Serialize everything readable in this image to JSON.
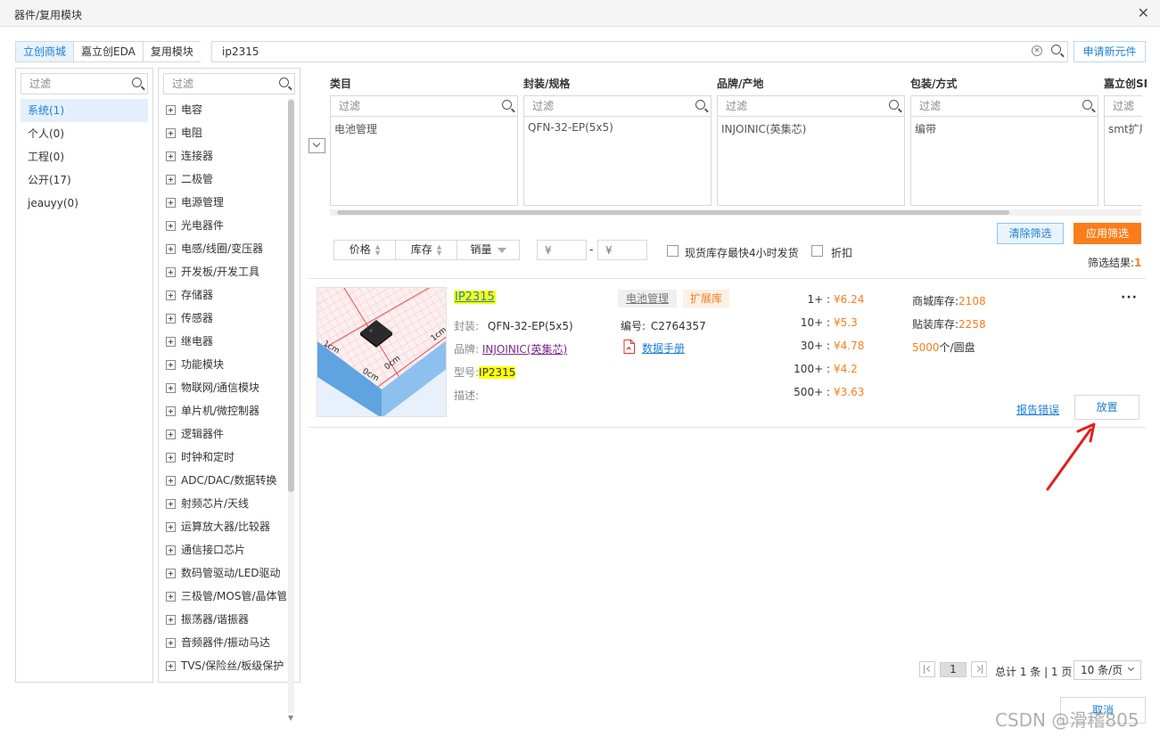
{
  "window": {
    "title": "器件/复用模块",
    "close": "✕"
  },
  "tabs": [
    {
      "label": "立创商城",
      "active": true
    },
    {
      "label": "嘉立创EDA",
      "active": false
    },
    {
      "label": "复用模块",
      "active": false
    }
  ],
  "search": {
    "value": "ip2315",
    "clear": "✕"
  },
  "new_part_button": "申请新元件",
  "filter_placeholder": "过滤",
  "libraries": [
    "系统(1)",
    "个人(0)",
    "工程(0)",
    "公开(17)",
    "jeauyy(0)"
  ],
  "categories": [
    "电容",
    "电阻",
    "连接器",
    "二极管",
    "电源管理",
    "光电器件",
    "电感/线圈/变压器",
    "开发板/开发工具",
    "存储器",
    "传感器",
    "继电器",
    "功能模块",
    "物联网/通信模块",
    "单片机/微控制器",
    "逻辑器件",
    "时钟和定时",
    "ADC/DAC/数据转换",
    "射频芯片/天线",
    "运算放大器/比较器",
    "通信接口芯片",
    "数码管驱动/LED驱动",
    "三极管/MOS管/晶体管",
    "振荡器/谐振器",
    "音频器件/振动马达",
    "TVS/保险丝/板级保护"
  ],
  "facets": [
    {
      "title": "类目",
      "value": "电池管理"
    },
    {
      "title": "封装/规格",
      "value": "QFN-32-EP(5x5)"
    },
    {
      "title": "品牌/产地",
      "value": "INJOINIC(英集芯)"
    },
    {
      "title": "包装/方式",
      "value": "编带"
    },
    {
      "title": "嘉立创SMT",
      "value": "smt扩展"
    }
  ],
  "buttons": {
    "clear_filter": "清除筛选",
    "apply_filter": "应用筛选",
    "place": "放置",
    "report": "报告错误",
    "cancel": "取消"
  },
  "sort": {
    "price": "价格",
    "stock": "库存",
    "sales": "销量"
  },
  "price_range": {
    "min_placeholder": "¥",
    "max_placeholder": "¥",
    "dash": "-"
  },
  "checks": {
    "fast_ship": "现货库存最快4小时发货",
    "discount": "折扣"
  },
  "result": {
    "label": "筛选结果:",
    "count": "1"
  },
  "product": {
    "name": "IP2315",
    "category_tag": "电池管理",
    "lib_tag": "扩展库",
    "package_label": "封装:",
    "package": "QFN-32-EP(5x5)",
    "brand_label": "品牌:",
    "brand": "INJOINIC(英集芯)",
    "model_label": "型号:",
    "model": "IP2315",
    "desc_label": "描述:",
    "code_label": "编号:",
    "code": "C2764357",
    "datasheet": "数据手册",
    "prices": [
      {
        "qty": "1+ :",
        "price": "¥6.24"
      },
      {
        "qty": "10+ :",
        "price": "¥5.3"
      },
      {
        "qty": "30+ :",
        "price": "¥4.78"
      },
      {
        "qty": "100+ :",
        "price": "¥4.2"
      },
      {
        "qty": "500+ :",
        "price": "¥3.63"
      }
    ],
    "mall_stock_label": "商城库存:",
    "mall_stock": "2108",
    "smt_stock_label": "贴装库存:",
    "smt_stock": "2258",
    "reel_qty": "5000",
    "reel_unit": "个/圆盘",
    "more": "···",
    "thumb_label_1": "1cm",
    "thumb_label_2": "0cm"
  },
  "pagination": {
    "current": "1",
    "summary": "总计 1 条 | 1 页",
    "page_size": "10 条/页"
  },
  "watermark": "CSDN @滑稽805",
  "colors": {
    "accent": "#1a7fd4",
    "orange": "#fa7d1b",
    "highlight": "#ffff00",
    "annotation_arrow": "#e02020"
  }
}
